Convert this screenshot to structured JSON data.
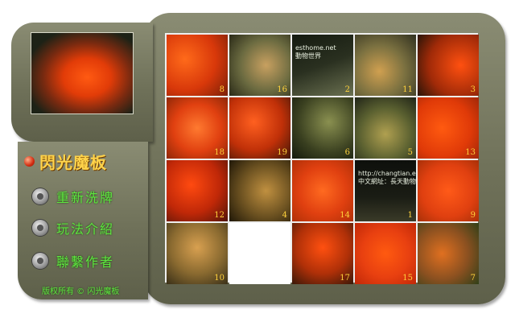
{
  "thumbnail": {
    "caption_top": "...",
    "caption_bottom": "..."
  },
  "menu": {
    "title": "閃光魔板",
    "items": [
      {
        "label": "重新洗牌",
        "icon": "disc-icon"
      },
      {
        "label": "玩法介紹",
        "icon": "disc-icon"
      },
      {
        "label": "聯繫作者",
        "icon": "disc-icon"
      }
    ]
  },
  "footer": "版权所有 © 闪光魔板",
  "board": {
    "rows": 4,
    "cols": 5,
    "tiles": [
      {
        "num": "8",
        "text": ""
      },
      {
        "num": "16",
        "text": ""
      },
      {
        "num": "2",
        "text": "esthome.net\n動物世界"
      },
      {
        "num": "11",
        "text": ""
      },
      {
        "num": "3",
        "text": ""
      },
      {
        "num": "18",
        "text": ""
      },
      {
        "num": "19",
        "text": ""
      },
      {
        "num": "6",
        "text": ""
      },
      {
        "num": "5",
        "text": ""
      },
      {
        "num": "13",
        "text": ""
      },
      {
        "num": "12",
        "text": ""
      },
      {
        "num": "4",
        "text": ""
      },
      {
        "num": "14",
        "text": ""
      },
      {
        "num": "1",
        "text": "http://changtian.e\n中文網址：長天動物"
      },
      {
        "num": "9",
        "text": ""
      },
      {
        "num": "10",
        "text": ""
      },
      {
        "num": "",
        "text": ""
      },
      {
        "num": "17",
        "text": ""
      },
      {
        "num": "15",
        "text": ""
      },
      {
        "num": "7",
        "text": ""
      }
    ]
  },
  "colors": {
    "panel": "#6f7159",
    "title": "#ffd34a",
    "menu_text": "#5ee640",
    "tile_number": "#ffd23c"
  }
}
